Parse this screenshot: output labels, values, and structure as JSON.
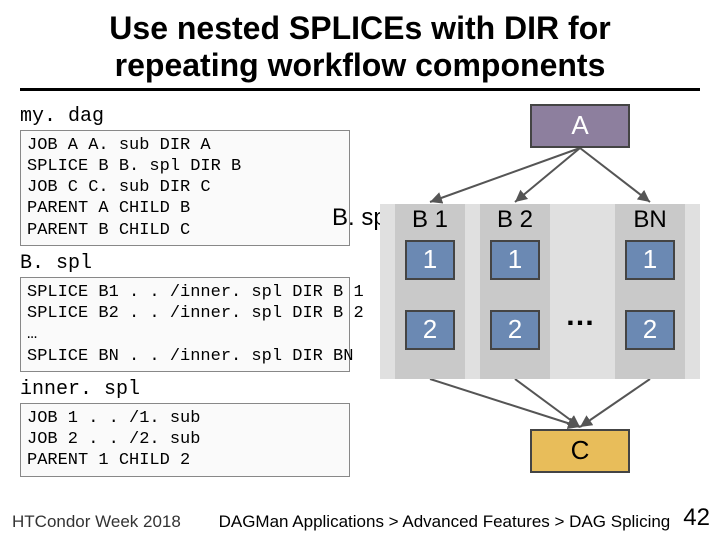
{
  "title": "Use nested SPLICEs with DIR for repeating workflow components",
  "file1": {
    "name": "my. dag",
    "code": "JOB A A. sub DIR A\nSPLICE B B. spl DIR B\nJOB C C. sub DIR C\nPARENT A CHILD B\nPARENT B CHILD C"
  },
  "file2": {
    "name": "B. spl",
    "code": "SPLICE B1 . . /inner. spl DIR B 1\nSPLICE B2 . . /inner. spl DIR B 2\n…\nSPLICE BN . . /inner. spl DIR BN"
  },
  "file3": {
    "name": "inner. spl",
    "code": "JOB 1 . . /1. sub\nJOB 2 . . /2. sub\nPARENT 1 CHILD 2"
  },
  "graph": {
    "A": "A",
    "C": "C",
    "bspl": "B. spl",
    "dots": "…",
    "cols": [
      {
        "label": "B 1",
        "n1": "1",
        "n2": "2"
      },
      {
        "label": "B 2",
        "n1": "1",
        "n2": "2"
      },
      {
        "label": "BN",
        "n1": "1",
        "n2": "2"
      }
    ]
  },
  "footer": {
    "left": "HTCondor Week 2018",
    "mid": "DAGMan Applications > Advanced Features > DAG Splicing",
    "right": "42"
  }
}
